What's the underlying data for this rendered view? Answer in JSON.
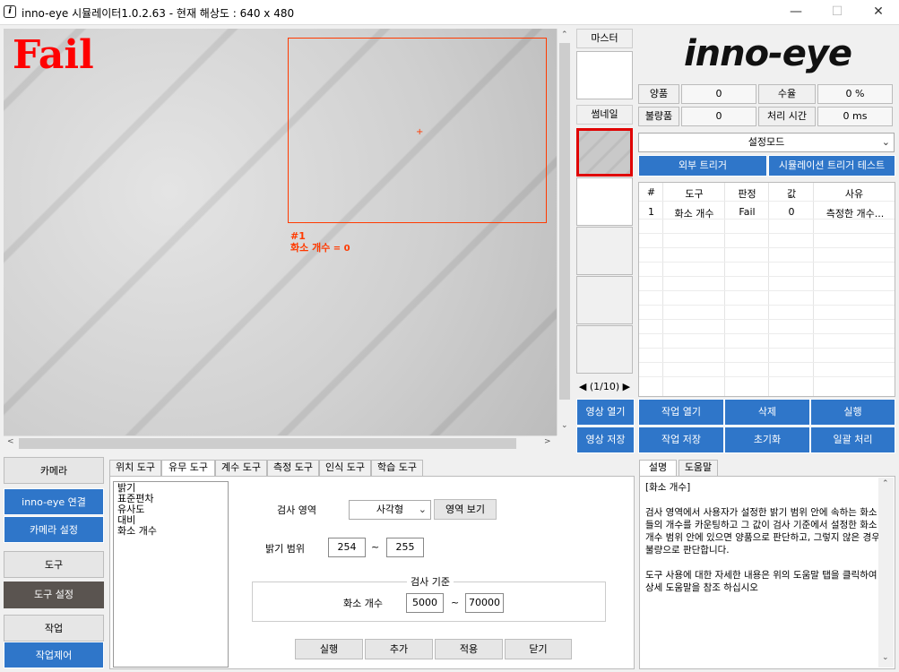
{
  "window": {
    "title": "inno-eye 시뮬레이터1.0.2.63 - 현재 해상도 : 640 x 480",
    "icon": "app-logo-icon",
    "controls": [
      "minimize",
      "maximize",
      "close"
    ]
  },
  "viewer": {
    "result_text": "Fail",
    "roi_index": "#1",
    "roi_label": "화소 개수",
    "roi_value": " = 0",
    "roi_color": "#ff3a00"
  },
  "thumbs": {
    "master_label": "마스터",
    "thumbnail_label": "썸네일",
    "pager": "(1/10)"
  },
  "image_buttons": {
    "open": "영상 열기",
    "save": "영상 저장"
  },
  "logo": "inno-eye",
  "stats": {
    "pass_label": "양품",
    "pass_value": "0",
    "yield_label": "수율",
    "yield_value": "0 %",
    "fail_label": "불량품",
    "fail_value": "0",
    "time_label": "처리 시간",
    "time_value": "0 ms"
  },
  "mode_select": "설정모드",
  "triggers": {
    "external": "외부 트리거",
    "simulation": "시뮬레이션 트리거 테스트"
  },
  "results": {
    "headers": [
      "#",
      "도구",
      "판정",
      "값",
      "사유"
    ],
    "rows": [
      [
        "1",
        "화소 개수",
        "Fail",
        "0",
        "측정한 개수..."
      ]
    ]
  },
  "job_buttons": {
    "open": "작업 열기",
    "delete": "삭제",
    "run": "실행",
    "save": "작업 저장",
    "reset": "초기화",
    "batch": "일괄 처리"
  },
  "sidebar": {
    "camera_header": "카메라",
    "connect": "inno-eye 연결",
    "camera_settings": "카메라 설정",
    "tool_header": "도구",
    "tool_settings": "도구 설정",
    "job_header": "작업",
    "job_control": "작업제어"
  },
  "tool_tabs": [
    "위치 도구",
    "유무 도구",
    "계수 도구",
    "측정 도구",
    "인식 도구",
    "학습 도구"
  ],
  "tool_list": [
    "밝기",
    "표준편차",
    "유사도",
    "대비",
    "화소 개수"
  ],
  "form": {
    "region_label": "검사 영역",
    "region_value": "사각형",
    "view_region": "영역 보기",
    "brightness_label": "밝기 범위",
    "brightness_min": "254",
    "tilde": "~",
    "brightness_max": "255",
    "criteria_title": "검사 기준",
    "pixel_count_label": "화소 개수",
    "count_min": "5000",
    "count_max": "70000",
    "run": "실행",
    "add": "추가",
    "apply": "적용",
    "close": "닫기"
  },
  "help": {
    "tabs": [
      "설명",
      "도움말"
    ],
    "text": "[화소 개수]\n\n검사 영역에서 사용자가 설정한 밝기 범위 안에 속하는 화소들의 개수를 카운팅하고 그 값이 검사 기준에서 설정한 화소 개수 범위 안에 있으면 양품으로 판단하고, 그렇지 않은 경우 불량으로 판단합니다.\n\n도구 사용에 대한 자세한 내용은 위의 도움말 탭을 클릭하여 상세 도움말을 참조 하십시오"
  },
  "colors": {
    "accent_blue": "#2f76c9",
    "fail_red": "#ff0000",
    "selected_thumb_border": "#e00000",
    "dark_button": "#5a5450"
  }
}
